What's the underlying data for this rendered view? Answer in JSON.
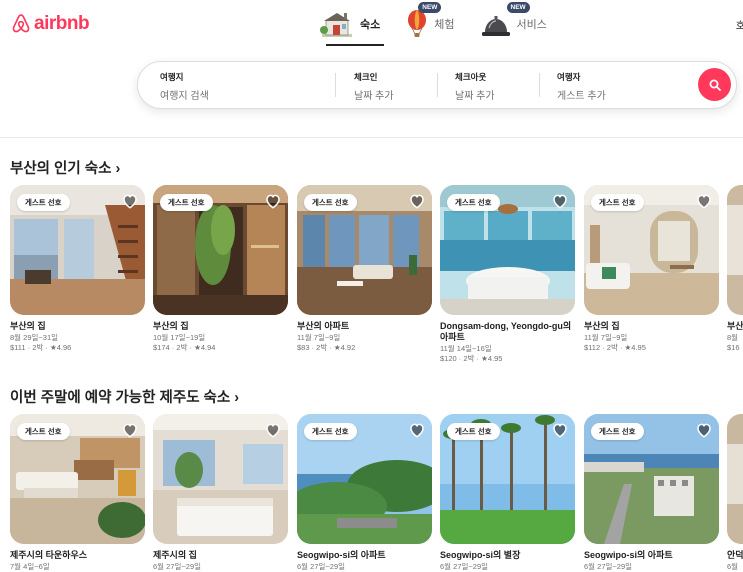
{
  "brand": {
    "name": "airbnb",
    "color": "#ff385c"
  },
  "tabs": [
    {
      "label": "숙소",
      "icon": "house-icon",
      "active": true,
      "new": ""
    },
    {
      "label": "체험",
      "icon": "hot-air-balloon-icon",
      "active": false,
      "new": "NEW"
    },
    {
      "label": "서비스",
      "icon": "service-bell-icon",
      "active": false,
      "new": "NEW"
    }
  ],
  "header_right": "호",
  "search": {
    "where": {
      "label": "여행지",
      "placeholder": "여행지 검색"
    },
    "checkin": {
      "label": "체크인",
      "placeholder": "날짜 추가"
    },
    "checkout": {
      "label": "체크아웃",
      "placeholder": "날짜 추가"
    },
    "guests": {
      "label": "여행자",
      "placeholder": "게스트 추가"
    },
    "button_icon": "search-icon"
  },
  "sections": [
    {
      "title": "부산의 인기 숙소 ›",
      "cards": [
        {
          "badge": "게스트 선호",
          "title": "부산의 집",
          "dates": "8월 29일~31일",
          "price": "$111 · 2박",
          "rating": "★4.96"
        },
        {
          "badge": "게스트 선호",
          "title": "부산의 집",
          "dates": "10월 17일~19일",
          "price": "$174 · 2박",
          "rating": "★4.94"
        },
        {
          "badge": "게스트 선호",
          "title": "부산의 아파트",
          "dates": "11월 7일~9일",
          "price": "$83 · 2박",
          "rating": "★4.92"
        },
        {
          "badge": "게스트 선호",
          "title": "Dongsam-dong, Yeongdo-gu의 아파트",
          "dates": "11월 14일~16일",
          "price": "$120 · 2박",
          "rating": "★4.95"
        },
        {
          "badge": "게스트 선호",
          "title": "부산의 집",
          "dates": "11월 7일~9일",
          "price": "$112 · 2박",
          "rating": "★4.95"
        },
        {
          "badge": "",
          "title": "부산",
          "dates": "8월",
          "price": "$16",
          "rating": ""
        }
      ]
    },
    {
      "title": "이번 주말에 예약 가능한 제주도 숙소 ›",
      "cards": [
        {
          "badge": "게스트 선호",
          "title": "제주시의 타운하우스",
          "dates": "7월 4일~6일",
          "price": "",
          "rating": ""
        },
        {
          "badge": "",
          "title": "제주시의 집",
          "dates": "6월 27일~29일",
          "price": "",
          "rating": ""
        },
        {
          "badge": "게스트 선호",
          "title": "Seogwipo-si의 아파트",
          "dates": "6월 27일~29일",
          "price": "",
          "rating": ""
        },
        {
          "badge": "게스트 선호",
          "title": "Seogwipo-si의 별장",
          "dates": "6월 27일~29일",
          "price": "",
          "rating": ""
        },
        {
          "badge": "게스트 선호",
          "title": "Seogwipo-si의 아파트",
          "dates": "6월 27일~29일",
          "price": "",
          "rating": ""
        },
        {
          "badge": "",
          "title": "안덕",
          "dates": "6월",
          "price": "",
          "rating": ""
        }
      ]
    }
  ]
}
